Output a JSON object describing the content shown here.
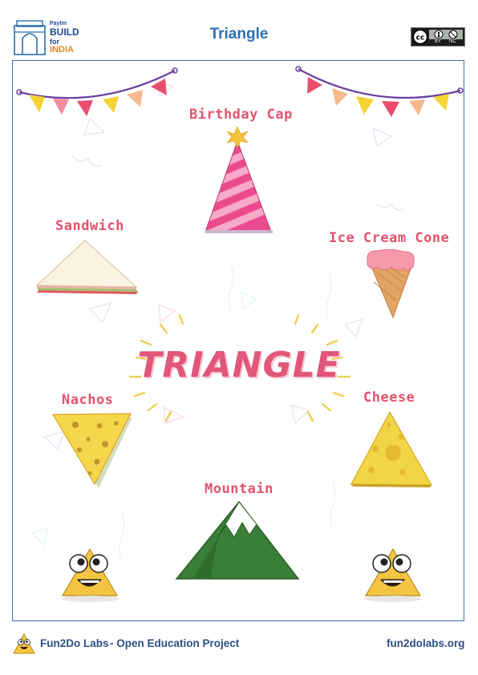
{
  "header": {
    "title": "Triangle",
    "logo_small": "Paytm",
    "logo_line1": "BUILD",
    "logo_line2": "for",
    "logo_line3": "INDIA",
    "license_labels": [
      "BY",
      "NC"
    ]
  },
  "main": {
    "heading": "TRIANGLE",
    "items": [
      {
        "label": "Birthday Cap"
      },
      {
        "label": "Sandwich"
      },
      {
        "label": "Ice Cream Cone"
      },
      {
        "label": "Nachos"
      },
      {
        "label": "Cheese"
      },
      {
        "label": "Mountain"
      }
    ]
  },
  "footer": {
    "brand": "Fun2Do Labs",
    "tagline": "- Open Education Project",
    "website": "fun2dolabs.org"
  },
  "colors": {
    "title_blue": "#2c6fb3",
    "label_pink": "#e3526d",
    "frame_blue": "#3e6fb0"
  },
  "icons": [
    "india-gate-icon",
    "cc-icon",
    "person-icon",
    "no-dollar-icon",
    "nacho-mascot-icon"
  ]
}
